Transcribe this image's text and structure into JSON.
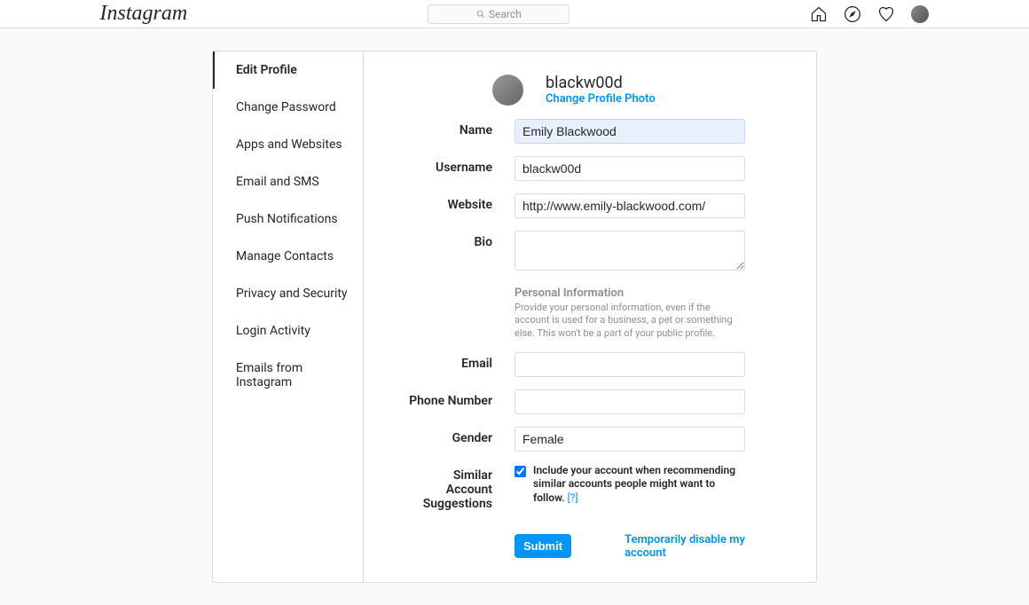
{
  "header": {
    "logo": "Instagram",
    "search_placeholder": "Search"
  },
  "sidebar": {
    "items": [
      {
        "label": "Edit Profile",
        "active": true
      },
      {
        "label": "Change Password",
        "active": false
      },
      {
        "label": "Apps and Websites",
        "active": false
      },
      {
        "label": "Email and SMS",
        "active": false
      },
      {
        "label": "Push Notifications",
        "active": false
      },
      {
        "label": "Manage Contacts",
        "active": false
      },
      {
        "label": "Privacy and Security",
        "active": false
      },
      {
        "label": "Login Activity",
        "active": false
      },
      {
        "label": "Emails from Instagram",
        "active": false
      }
    ]
  },
  "profile": {
    "username": "blackw00d",
    "change_photo_label": "Change Profile Photo"
  },
  "form": {
    "labels": {
      "name": "Name",
      "username": "Username",
      "website": "Website",
      "bio": "Bio",
      "email": "Email",
      "phone": "Phone Number",
      "gender": "Gender",
      "similar": "Similar Account Suggestions"
    },
    "values": {
      "name": "Emily Blackwood",
      "username": "blackw00d",
      "website": "http://www.emily-blackwood.com/",
      "bio": "",
      "email": "",
      "phone": "",
      "gender": "Female"
    },
    "personal_info": {
      "title": "Personal Information",
      "desc": "Provide your personal information, even if the account is used for a business, a pet or something else. This won't be a part of your public profile."
    },
    "similar_checkbox": {
      "checked": true,
      "label": "Include your account when recommending similar accounts people might want to follow.",
      "help": "[?]"
    },
    "submit_label": "Submit",
    "disable_label": "Temporarily disable my account"
  }
}
